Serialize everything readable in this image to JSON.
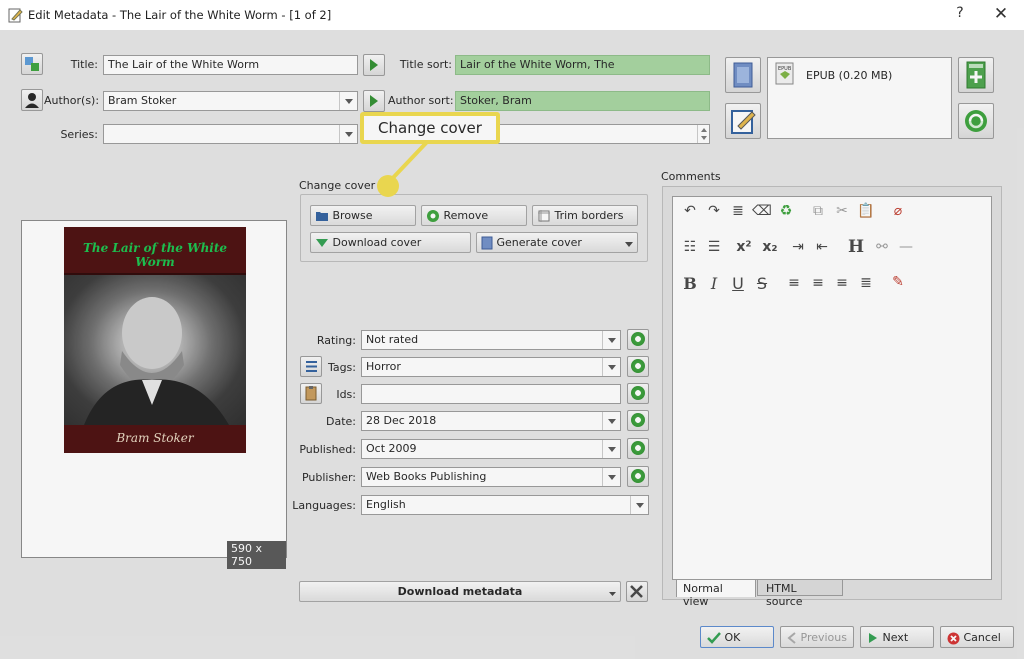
{
  "window": {
    "title": "Edit Metadata -  The Lair of the White Worm -   [1 of 2]",
    "help_label": "?",
    "close_label": "✕"
  },
  "fields": {
    "title_label": "Title:",
    "title_value": "The Lair of the White Worm",
    "title_sort_label": "Title sort:",
    "title_sort_value": "Lair of the White Worm, The",
    "authors_label": "Author(s):",
    "authors_value": "Bram Stoker",
    "author_sort_label": "Author sort:",
    "author_sort_value": "Stoker, Bram",
    "series_label": "Series:",
    "series_value": ""
  },
  "formats": {
    "item": "EPUB (0.20 MB)",
    "item_icon": "epub-file-icon"
  },
  "callout": {
    "text": "Change cover",
    "color": "#f2dd4c"
  },
  "change_cover": {
    "heading": "Change cover",
    "browse": "Browse",
    "remove": "Remove",
    "trim": "Trim borders",
    "download": "Download cover",
    "generate": "Generate cover"
  },
  "cover": {
    "title": "The Lair of the White Worm",
    "author": "Bram Stoker",
    "size": "590 x 750"
  },
  "meta": {
    "rating_label": "Rating:",
    "rating_value": "Not rated",
    "tags_label": "Tags:",
    "tags_value": "Horror",
    "ids_label": "Ids:",
    "ids_value": "",
    "date_label": "Date:",
    "date_value": "28 Dec 2018",
    "published_label": "Published:",
    "published_value": "Oct 2009",
    "publisher_label": "Publisher:",
    "publisher_value": "Web Books Publishing",
    "languages_label": "Languages:",
    "languages_value": "English"
  },
  "comments": {
    "label": "Comments",
    "tab_normal": "Normal view",
    "tab_html": "HTML source"
  },
  "download_metadata": "Download metadata",
  "footer": {
    "ok": "OK",
    "previous": "Previous",
    "next": "Next",
    "cancel": "Cancel"
  }
}
